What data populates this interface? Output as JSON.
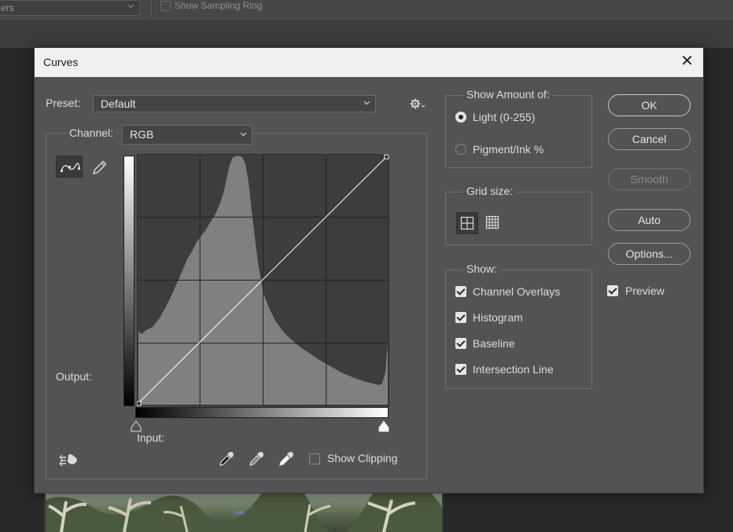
{
  "background": {
    "options_dropdown_text": "ers",
    "show_sampling_ring_label": "Show Sampling Ring"
  },
  "dialog": {
    "title": "Curves",
    "preset": {
      "label": "Preset:",
      "value": "Default"
    },
    "channel": {
      "label": "Channel:",
      "value": "RGB"
    },
    "output_label": "Output:",
    "input_label": "Input:",
    "show_clipping_label": "Show Clipping",
    "show_amount": {
      "title": "Show Amount of:",
      "options": [
        {
          "label": "Light  (0-255)",
          "selected": true
        },
        {
          "label": "Pigment/Ink %",
          "selected": false
        }
      ]
    },
    "grid_size": {
      "title": "Grid size:",
      "selected": "4x4"
    },
    "show": {
      "title": "Show:",
      "items": [
        {
          "label": "Channel Overlays",
          "checked": true
        },
        {
          "label": "Histogram",
          "checked": true
        },
        {
          "label": "Baseline",
          "checked": true
        },
        {
          "label": "Intersection Line",
          "checked": true
        }
      ]
    },
    "buttons": {
      "ok": "OK",
      "cancel": "Cancel",
      "smooth": "Smooth",
      "auto": "Auto",
      "options": "Options..."
    },
    "preview": {
      "label": "Preview",
      "checked": true
    },
    "colors": {
      "dialog_bg": "#535353",
      "histogram_fill": "#808080",
      "curve_bg": "#3d3d3d",
      "curve_line": "#ffffff"
    }
  }
}
